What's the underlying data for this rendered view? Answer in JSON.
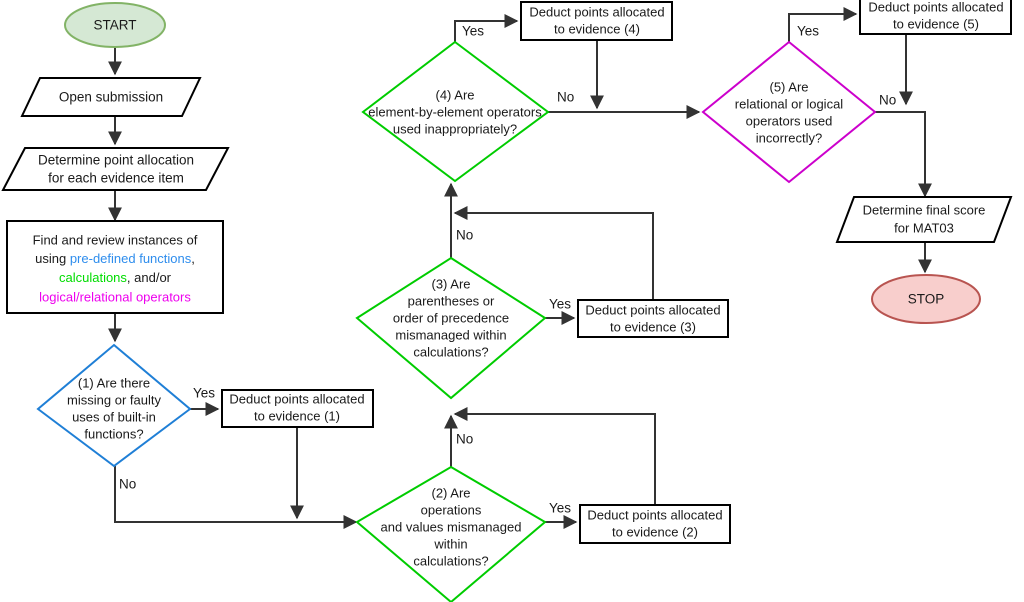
{
  "diagram": {
    "title": "MAT03 grading flowchart",
    "colors": {
      "start_fill": "#d5e8d4",
      "start_stroke": "#82b366",
      "stop_fill": "#f8cecc",
      "stop_stroke": "#b85450",
      "decision_blue": "#1f7fd6",
      "decision_green": "#00cc00",
      "decision_pink": "#cc00cc",
      "edge": "#333333",
      "keyword_functions": "#2e8ded",
      "keyword_calculations": "#00dd00",
      "keyword_operators": "#ee00ee"
    }
  },
  "nodes": {
    "start": {
      "label": "START",
      "shape": "terminator"
    },
    "open_submission": {
      "label": "Open submission",
      "shape": "io"
    },
    "determine_points": {
      "shape": "io",
      "line1": "Determine point allocation",
      "line2": "for each evidence item"
    },
    "find_review": {
      "shape": "process",
      "line1": "Find and review instances of",
      "line2_plain": "using ",
      "line2_kw": "pre-defined functions",
      "line2_tail": ",",
      "line3_kw": "calculations",
      "line3_tail": ", and/or",
      "line4_kw": "logical/relational operators"
    },
    "decision1": {
      "shape": "decision",
      "color": "blue",
      "line1": "(1) Are there",
      "line2": "missing or faulty",
      "line3": "uses of built-in",
      "line4": "functions?"
    },
    "decision2": {
      "shape": "decision",
      "color": "green",
      "line1": "(2) Are",
      "line2": "operations",
      "line3": "and values mismanaged",
      "line4": "within",
      "line5": "calculations?"
    },
    "decision3": {
      "shape": "decision",
      "color": "green",
      "line1": "(3) Are",
      "line2": "parentheses or",
      "line3": "order of precedence",
      "line4": "mismanaged within",
      "line5": "calculations?"
    },
    "decision4": {
      "shape": "decision",
      "color": "green",
      "line1": "(4) Are",
      "line2": "element-by-element operators",
      "line3": "used inappropriately?"
    },
    "decision5": {
      "shape": "decision",
      "color": "pink",
      "line1": "(5) Are",
      "line2": "relational or logical",
      "line3": "operators used",
      "line4": "incorrectly?"
    },
    "deduct1": {
      "shape": "process",
      "line1": "Deduct points allocated",
      "line2": "to evidence (1)"
    },
    "deduct2": {
      "shape": "process",
      "line1": "Deduct points allocated",
      "line2": "to evidence (2)"
    },
    "deduct3": {
      "shape": "process",
      "line1": "Deduct points allocated",
      "line2": "to evidence (3)"
    },
    "deduct4": {
      "shape": "process",
      "line1": "Deduct points allocated",
      "line2": "to evidence (4)"
    },
    "deduct5": {
      "shape": "process",
      "line1": "Deduct points allocated",
      "line2": "to evidence (5)"
    },
    "final_score": {
      "shape": "io",
      "line1": "Determine final score",
      "line2": "for MAT03"
    },
    "stop": {
      "label": "STOP",
      "shape": "terminator"
    }
  },
  "edge_labels": {
    "d1_yes": "Yes",
    "d1_no": "No",
    "d2_yes": "Yes",
    "d2_no": "No",
    "d3_yes": "Yes",
    "d3_no": "No",
    "d4_yes": "Yes",
    "d4_no": "No",
    "d5_yes": "Yes",
    "d5_no": "No"
  }
}
